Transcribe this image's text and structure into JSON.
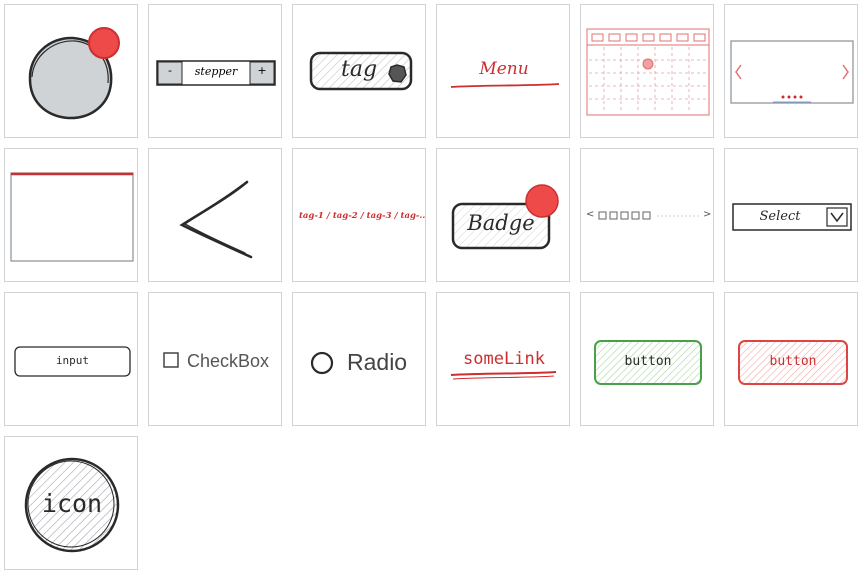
{
  "colors": {
    "accent_red": "#cc2f2f",
    "badge_red": "#ee4a4a",
    "sketch_dark": "#2a2a2a",
    "cell_border": "#cfd3d6",
    "green": "#4aa04a",
    "hatch_gray": "#d5d9dd"
  },
  "stepper": {
    "minus": "-",
    "label": "stepper",
    "plus": "+"
  },
  "tag": {
    "label": "tag"
  },
  "menu": {
    "label": "Menu"
  },
  "breadcrumb": {
    "text": "tag-1 / tag-2 / tag-3 / tag-..."
  },
  "badge": {
    "label": "Badge"
  },
  "pagination": {
    "prev": "<",
    "next": ">"
  },
  "select": {
    "label": "Select"
  },
  "input": {
    "label": "input"
  },
  "checkbox": {
    "label": "CheckBox"
  },
  "radio": {
    "label": "Radio"
  },
  "link": {
    "label": "someLink"
  },
  "button_green": {
    "label": "button"
  },
  "button_red": {
    "label": "button"
  },
  "icon": {
    "label": "icon"
  },
  "icons": [
    "avatar-icon",
    "notification-dot-icon",
    "calendar-icon",
    "carousel-icon",
    "chevron-left-icon",
    "chevron-down-icon"
  ]
}
